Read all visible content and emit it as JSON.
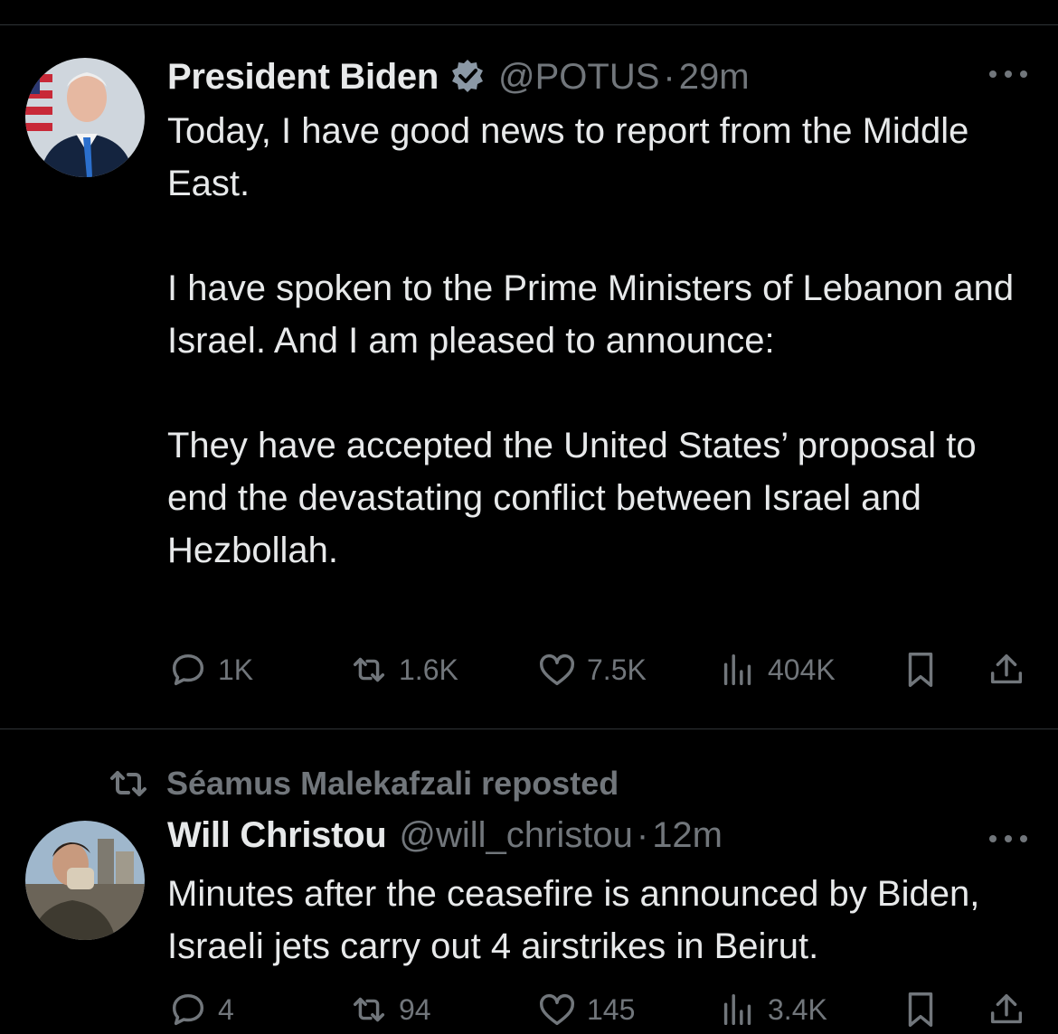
{
  "tweets": [
    {
      "name": "President Biden",
      "verified": true,
      "handle": "@POTUS",
      "separator": "·",
      "time": "29m",
      "paragraphs": [
        "Today, I have good news to report from the Middle East.",
        "I have spoken to the Prime Ministers of Lebanon and Israel. And I am pleased to announce:",
        "They have accepted the United States’ proposal to end the devastating conflict between Israel and Hezbollah."
      ],
      "stats": {
        "replies": "1K",
        "reposts": "1.6K",
        "likes": "7.5K",
        "views": "404K"
      }
    },
    {
      "reposted_by": "Séamus Malekafzali reposted",
      "name": "Will Christou",
      "handle": "@will_christou",
      "separator": "·",
      "time": "12m",
      "paragraphs": [
        "Minutes after the ceasefire is announced by Biden, Israeli jets carry out 4 airstrikes in Beirut."
      ],
      "stats": {
        "replies": "4",
        "reposts": "94",
        "likes": "145",
        "views": "3.4K"
      }
    }
  ],
  "colors": {
    "background": "#000000",
    "text": "#e7e9ea",
    "muted": "#71767b",
    "verified": "#1d9bf0",
    "divider": "#2f3336"
  },
  "icons": [
    "more-icon",
    "verified-badge-icon",
    "reply-icon",
    "repost-icon",
    "like-icon",
    "views-icon",
    "bookmark-icon",
    "share-icon"
  ]
}
